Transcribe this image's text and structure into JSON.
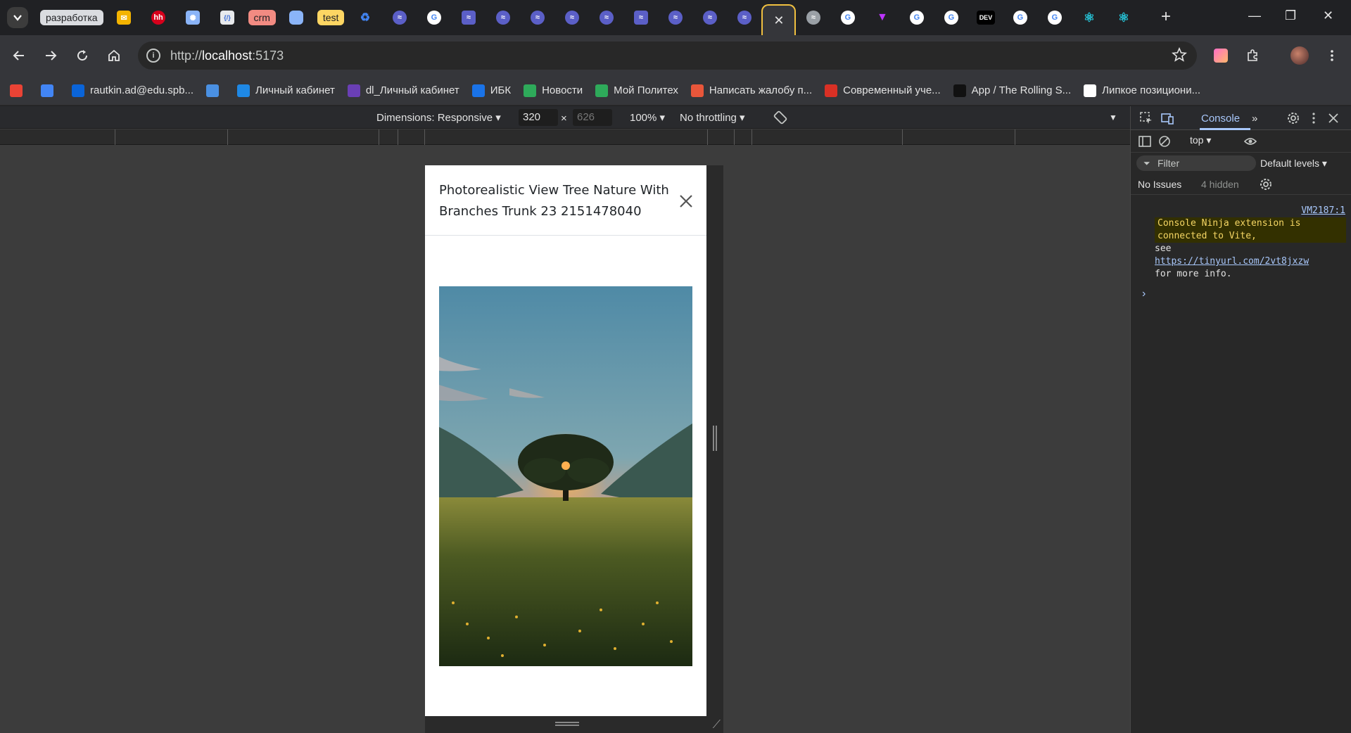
{
  "tabstrip": {
    "group_chip_1": "разработка",
    "group_chip_crm": "crm",
    "group_chip_test": "test",
    "hh_fav": "hh",
    "dev_fav": "DEV"
  },
  "toolbar": {
    "url_scheme": "http://",
    "url_host": "localhost",
    "url_port": ":5173",
    "info_glyph": "i"
  },
  "bookmarks": [
    {
      "label": "",
      "icon": "gmail-icon",
      "color": "#ea4335"
    },
    {
      "label": "",
      "icon": "gmail-m-icon",
      "color": "#4285f4"
    },
    {
      "label": "rautkin.ad@edu.spb...",
      "icon": "outlook-icon",
      "color": "#0a64d8"
    },
    {
      "label": "",
      "icon": "loader-icon",
      "color": "#4a90e2"
    },
    {
      "label": "Личный кабинет",
      "icon": "polytech-icon",
      "color": "#1e88e5"
    },
    {
      "label": "dl_Личный кабинет",
      "icon": "dl-icon",
      "color": "#6a3fb5"
    },
    {
      "label": "ИБК",
      "icon": "ibk-icon",
      "color": "#1a73e8"
    },
    {
      "label": "Новости",
      "icon": "news-icon",
      "color": "#2eaa5a"
    },
    {
      "label": "Мой Политех",
      "icon": "mypolytech-icon",
      "color": "#2eaa5a"
    },
    {
      "label": "Написать жалобу п...",
      "icon": "complaint-icon",
      "color": "#e8563a"
    },
    {
      "label": "Современный уче...",
      "icon": "figure-icon",
      "color": "#d93025"
    },
    {
      "label": "App / The Rolling S...",
      "icon": "rs-icon",
      "color": "#111111"
    },
    {
      "label": "Липкое позициони...",
      "icon": "wr-icon",
      "color": "#ffffff"
    }
  ],
  "device_toolbar": {
    "dimensions": "Dimensions: Responsive ▾",
    "width": "320",
    "times": "×",
    "height": "626",
    "zoom": "100% ▾",
    "throttling": "No throttling ▾"
  },
  "modal": {
    "title": "Photorealistic View Tree Nature With Branches Trunk 23 2151478040"
  },
  "devtools": {
    "console_tab": "Console",
    "context": "top ▾",
    "filter_placeholder": "Filter",
    "levels": "Default levels ▾",
    "issues": "No Issues",
    "hidden": "4 hidden",
    "source": "VM2187:1",
    "msg_highlight": "Console Ninja extension is connected to Vite,",
    "msg_see": "see",
    "msg_link": "https://tinyurl.com/2vt8jxzw",
    "msg_end": "for more info.",
    "prompt": "›"
  }
}
